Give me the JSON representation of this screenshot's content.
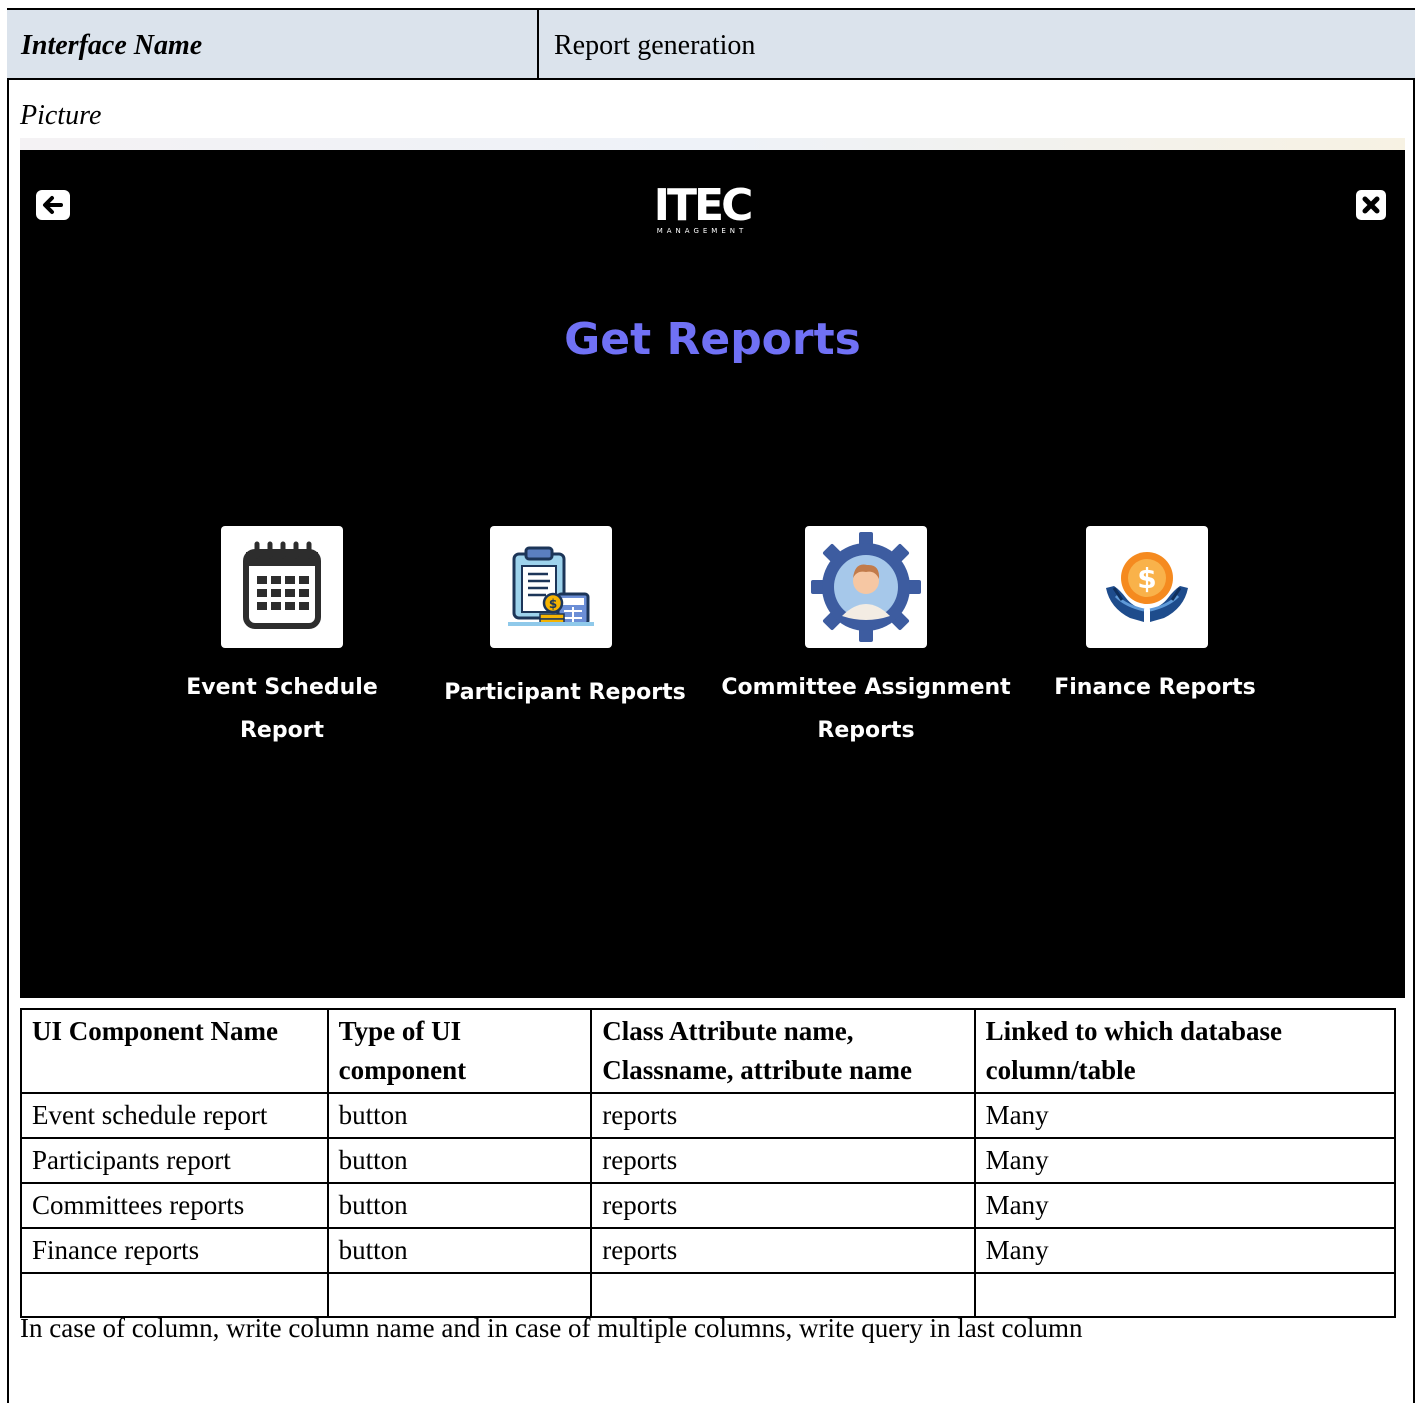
{
  "header": {
    "label": "Interface Name",
    "value": "Report generation"
  },
  "picture_label": "Picture",
  "app": {
    "logo_main": "ITEC",
    "logo_sub": "MANAGEMENT",
    "heading": "Get Reports",
    "icons": {
      "back": "arrow-left-icon",
      "close": "close-x-icon"
    },
    "cards": [
      {
        "label_line1": "Event Schedule",
        "label_line2": "Report",
        "icon": "calendar-icon"
      },
      {
        "label_line1": "Participant Reports",
        "label_line2": "",
        "icon": "clipboard-calculator-icon"
      },
      {
        "label_line1": "Committee Assignment",
        "label_line2": "Reports",
        "icon": "person-gear-icon"
      },
      {
        "label_line1": "Finance Reports",
        "label_line2": "",
        "icon": "hands-coin-icon"
      }
    ],
    "colors": {
      "heading": "#7071f5",
      "background": "#000000"
    }
  },
  "table": {
    "headers": [
      "UI Component Name",
      "Type of UI component",
      "Class Attribute name, Classname, attribute name",
      "Linked to which database column/table"
    ],
    "rows": [
      [
        "Event schedule report",
        "button",
        "reports",
        "Many"
      ],
      [
        "Participants report",
        "button",
        "reports",
        "Many"
      ],
      [
        "Committees reports",
        "button",
        "reports",
        "Many"
      ],
      [
        "Finance reports",
        "button",
        "reports",
        "Many"
      ],
      [
        "",
        "",
        "",
        ""
      ]
    ]
  },
  "footnote": "In case of column, write column name and in case of multiple columns, write query in last column"
}
